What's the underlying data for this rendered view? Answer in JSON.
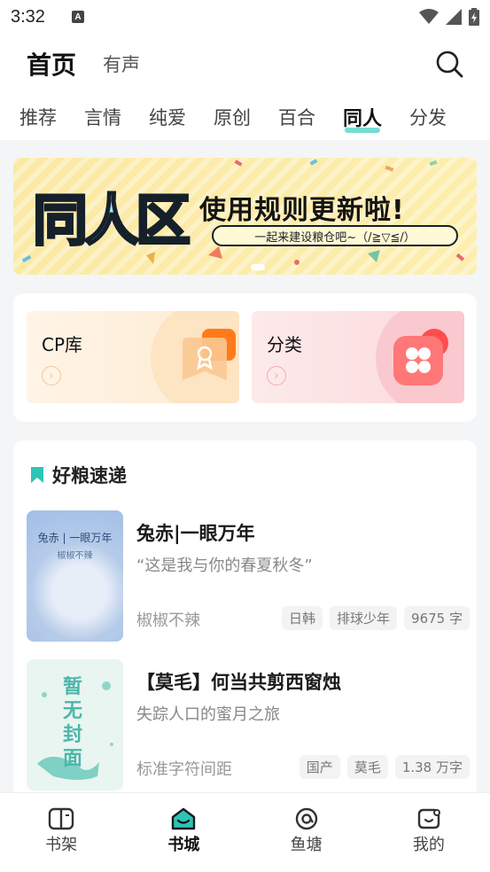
{
  "status_bar": {
    "time": "3:32",
    "notif_letter": "A"
  },
  "header": {
    "title": "首页",
    "subtitle": "有声"
  },
  "tabs": [
    {
      "label": "推荐"
    },
    {
      "label": "言情"
    },
    {
      "label": "纯爱"
    },
    {
      "label": "原创"
    },
    {
      "label": "百合"
    },
    {
      "label": "同人",
      "active": true
    },
    {
      "label": "分发"
    }
  ],
  "banner": {
    "logo_text": "同人区",
    "headline": "使用规则更新啦!",
    "subline": "一起来建设粮仓吧~（/≧▽≦/）"
  },
  "entries": {
    "cp_label": "CP库",
    "category_label": "分类"
  },
  "recommend": {
    "title": "好粮速递",
    "books": [
      {
        "title": "兔赤|一眼万年",
        "desc": "“这是我与你的春夏秋冬”",
        "author": "椒椒不辣",
        "tags": [
          "日韩",
          "排球少年",
          "9675 字"
        ],
        "cover_title": "兔赤 | 一眼万年",
        "cover_author": "椒椒不辣"
      },
      {
        "title": "【莫毛】何当共剪西窗烛",
        "desc": "失踪人口的蜜月之旅",
        "author": "标准字符间距",
        "tags": [
          "国产",
          "莫毛",
          "1.38 万字"
        ],
        "cover_title": "暂无封面"
      }
    ]
  },
  "bottom_nav": [
    {
      "label": "书架"
    },
    {
      "label": "书城",
      "active": true
    },
    {
      "label": "鱼塘"
    },
    {
      "label": "我的"
    }
  ],
  "colors": {
    "accent": "#49d0c4",
    "background": "#f4f5f7"
  }
}
